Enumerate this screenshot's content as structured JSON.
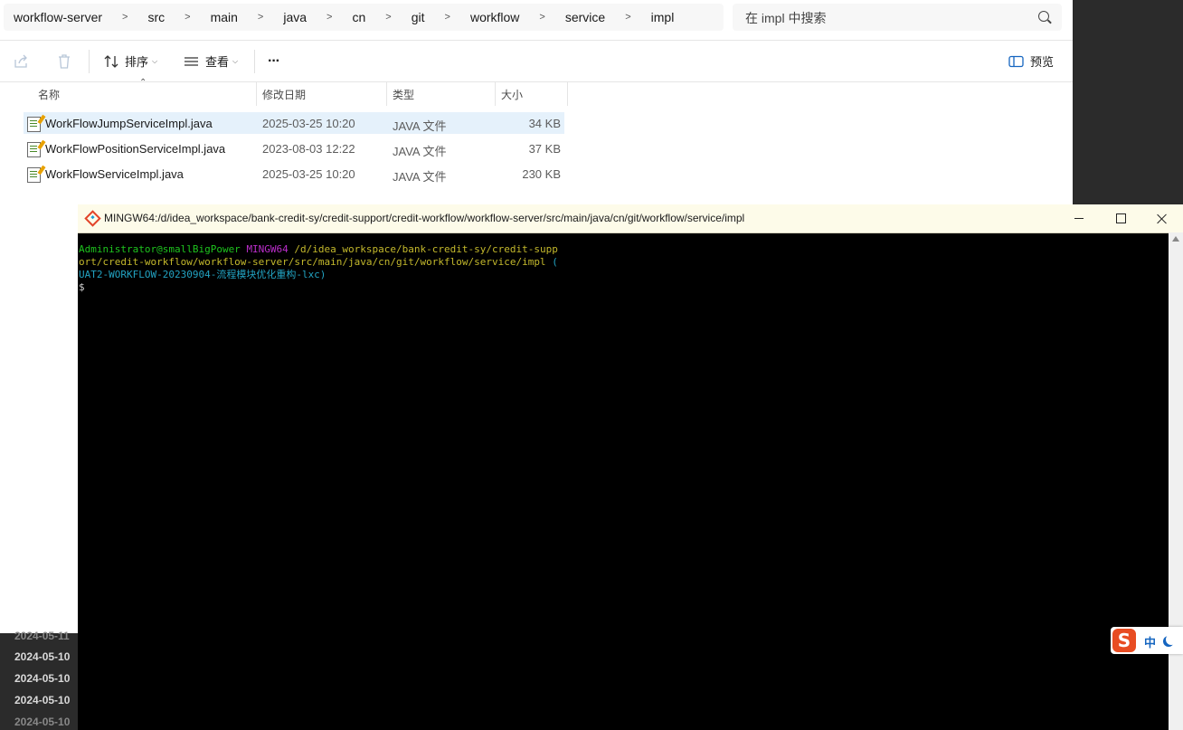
{
  "explorer": {
    "breadcrumb": [
      "workflow-server",
      "src",
      "main",
      "java",
      "cn",
      "git",
      "workflow",
      "service",
      "impl"
    ],
    "search_placeholder": "在 impl 中搜索",
    "toolbar": {
      "sort_label": "排序",
      "view_label": "查看",
      "more_label": "···",
      "preview_label": "预览"
    },
    "columns": {
      "name": "名称",
      "modified": "修改日期",
      "type": "类型",
      "size": "大小"
    },
    "files": [
      {
        "name": "WorkFlowJumpServiceImpl.java",
        "modified": "2025-03-25 10:20",
        "type": "JAVA 文件",
        "size": "34 KB",
        "selected": true
      },
      {
        "name": "WorkFlowPositionServiceImpl.java",
        "modified": "2023-08-03 12:22",
        "type": "JAVA 文件",
        "size": "37 KB",
        "selected": false
      },
      {
        "name": "WorkFlowServiceImpl.java",
        "modified": "2025-03-25 10:20",
        "type": "JAVA 文件",
        "size": "230 KB",
        "selected": false
      }
    ]
  },
  "background_dates": [
    "2024-05-11",
    "2024-05-10",
    "2024-05-10",
    "2024-05-10",
    "2024-05-10"
  ],
  "terminal": {
    "title": "MINGW64:/d/idea_workspace/bank-credit-sy/credit-support/credit-workflow/workflow-server/src/main/java/cn/git/workflow/service/impl",
    "prompt_user": "Administrator@smallBigPower",
    "prompt_system": "MINGW64",
    "path_line1": "/d/idea_workspace/bank-credit-sy/credit-supp",
    "path_line2": "ort/credit-workflow/workflow-server/src/main/java/cn/git/workflow/service/impl",
    "branch_open": "(",
    "branch": "UAT2-WORKFLOW-20230904-流程模块优化重构-lxc)",
    "cursor_prompt": "$"
  },
  "ime": {
    "logo": "S",
    "mode": "中"
  }
}
